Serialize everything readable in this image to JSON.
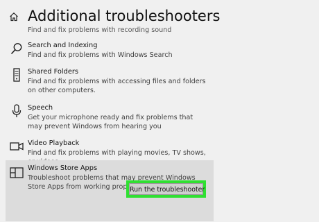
{
  "header": {
    "title": "Additional troubleshooters",
    "home_icon": "home-icon"
  },
  "partial_item": {
    "description": "Find and fix problems with recording sound"
  },
  "items": [
    {
      "title": "Search and Indexing",
      "description": "Find and fix problems with Windows Search",
      "icon": "search-icon"
    },
    {
      "title": "Shared Folders",
      "description": "Find and fix problems with accessing files and folders on other computers.",
      "icon": "server-icon"
    },
    {
      "title": "Speech",
      "description": "Get your microphone ready and fix problems that may prevent Windows from hearing you",
      "icon": "microphone-icon"
    },
    {
      "title": "Video Playback",
      "description": "Find and fix problems with playing movies, TV shows, or videos",
      "icon": "video-camera-icon"
    },
    {
      "title": "Windows Store Apps",
      "description": "Troubleshoot problems that may prevent Windows Store Apps from working properly",
      "icon": "store-apps-icon",
      "selected": true
    }
  ],
  "run_button": {
    "label": "Run the troubleshooter",
    "highlight_color": "#2fe032"
  }
}
